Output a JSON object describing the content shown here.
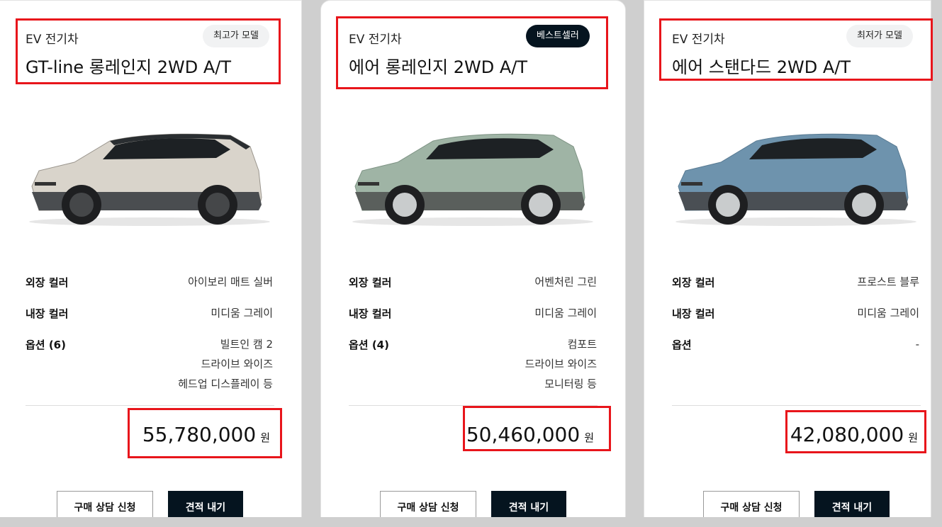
{
  "cards": [
    {
      "category": "EV 전기차",
      "badge": "최고가 모델",
      "title": "GT-line 롱레인지 2WD A/T",
      "exterior_label": "외장 컬러",
      "exterior_value": "아이보리 매트 실버",
      "interior_label": "내장 컬러",
      "interior_value": "미디움 그레이",
      "options_label": "옵션 (6)",
      "options": [
        "빌트인 캠 2",
        "드라이브 와이즈",
        "헤드업 디스플레이 등"
      ],
      "price": "55,780,000",
      "unit": "원",
      "consult_label": "구매 상담 신청",
      "quote_label": "견적 내기",
      "car_color": "#d9d4cb"
    },
    {
      "category": "EV 전기차",
      "badge": "베스트셀러",
      "title": "에어 롱레인지 2WD A/T",
      "exterior_label": "외장 컬러",
      "exterior_value": "어벤처린 그린",
      "interior_label": "내장 컬러",
      "interior_value": "미디움 그레이",
      "options_label": "옵션 (4)",
      "options": [
        "컴포트",
        "드라이브 와이즈",
        "모니터링 등"
      ],
      "price": "50,460,000",
      "unit": "원",
      "consult_label": "구매 상담 신청",
      "quote_label": "견적 내기",
      "car_color": "#9fb4a5"
    },
    {
      "category": "EV 전기차",
      "badge": "최저가 모델",
      "title": "에어 스탠다드 2WD A/T",
      "exterior_label": "외장 컬러",
      "exterior_value": "프로스트 블루",
      "interior_label": "내장 컬러",
      "interior_value": "미디움 그레이",
      "options_label": "옵션",
      "options": [
        "-"
      ],
      "price": "42,080,000",
      "unit": "원",
      "consult_label": "구매 상담 신청",
      "quote_label": "견적 내기",
      "car_color": "#6e93ad"
    }
  ],
  "colors": {
    "highlight": "#e8151b",
    "dark_button": "#05141f",
    "badge_light": "#f1f2f3"
  }
}
